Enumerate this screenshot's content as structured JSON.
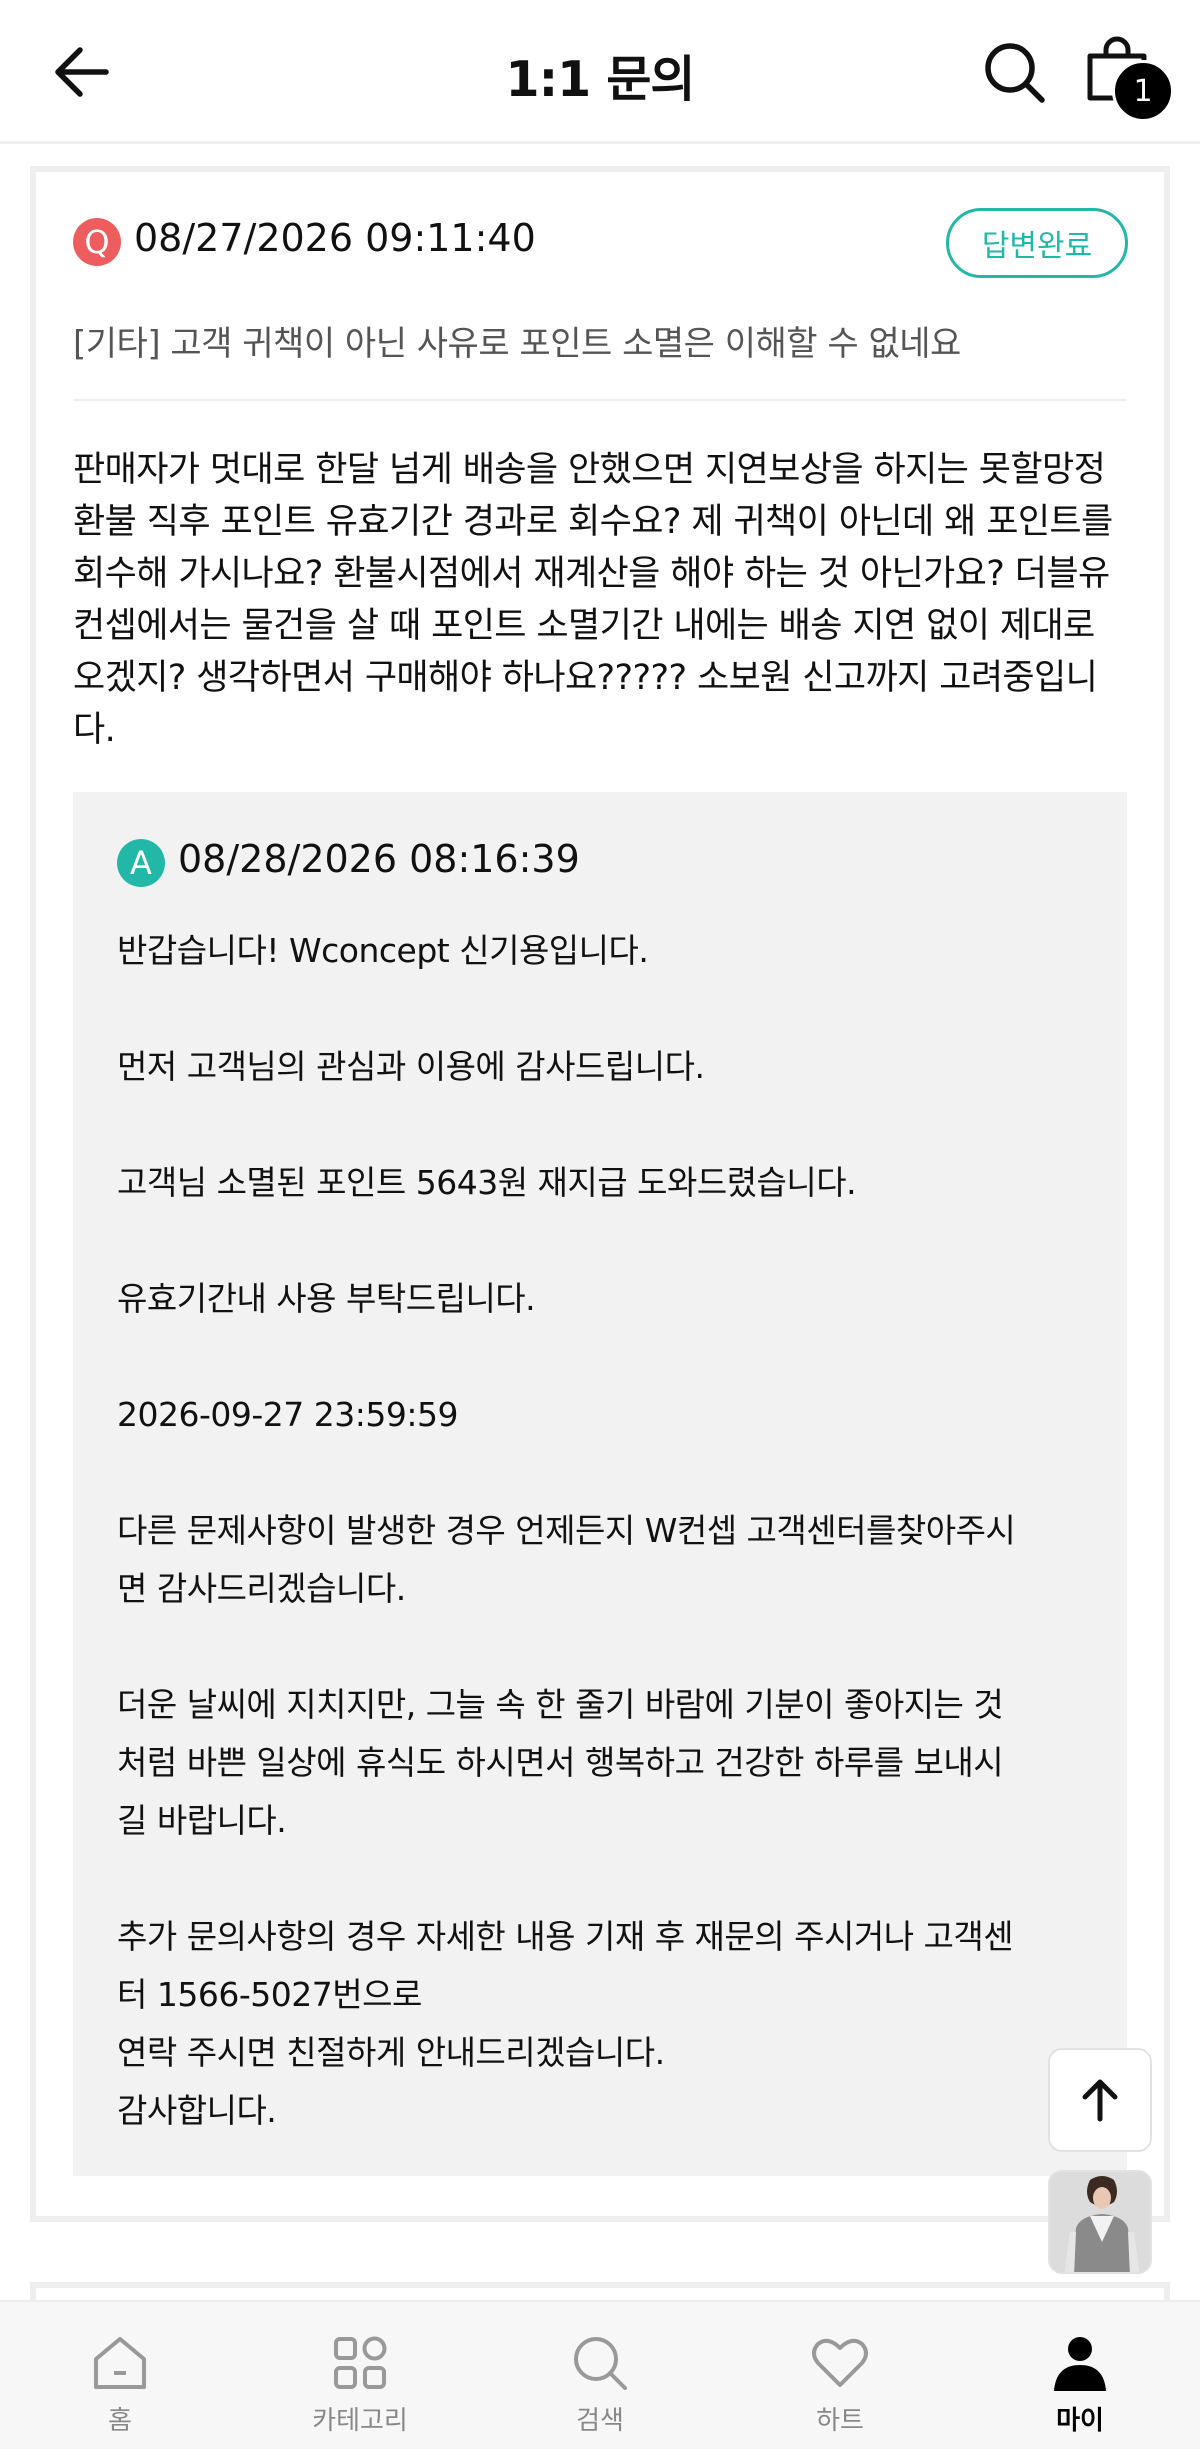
{
  "header": {
    "title": "1:1 문의",
    "cart_count": "1"
  },
  "question": {
    "icon_letter": "Q",
    "datetime": "08/27/2026 09:11:40",
    "status": "답변완료",
    "title": "[기타] 고객 귀책이 아닌 사유로 포인트 소멸은 이해할 수 없네요",
    "body_lines": [
      "판매자가 멋대로 한달 넘게 배송을 안했으면 지연보상을 하지는 못할망정",
      "환불 직후 포인트 유효기간 경과로 회수요? 제 귀책이 아닌데 왜 포인트를",
      "회수해 가시나요? 환불시점에서 재계산을 해야 하는 것 아닌가요? 더블유",
      "컨셉에서는 물건을 살 때 포인트 소멸기간 내에는 배송 지연 없이 제대로",
      "오겠지? 생각하면서 구매해야 하나요????? 소보원 신고까지 고려중입니",
      "다."
    ]
  },
  "answer": {
    "icon_letter": "A",
    "datetime": "08/28/2026 08:16:39",
    "p1": "반갑습니다! Wconcept 신기용입니다.",
    "p2": "먼저 고객님의 관심과 이용에 감사드립니다.",
    "p3": "고객님 소멸된 포인트 5643원 재지급 도와드렸습니다.",
    "p4": "유효기간내 사용 부탁드립니다.",
    "p5": "2026-09-27 23:59:59",
    "p6a": "다른 문제사항이 발생한 경우 언제든지 W컨셉 고객센터를찾아주시",
    "p6b": "면 감사드리겠습니다.",
    "p7a": "더운 날씨에 지치지만, 그늘 속 한 줄기 바람에 기분이 좋아지는 것",
    "p7b": "처럼 바쁜 일상에 휴식도 하시면서 행복하고 건강한 하루를 보내시",
    "p7c": "길 바랍니다.",
    "p8a": "추가 문의사항의 경우 자세한 내용 기재 후 재문의 주시거나 고객센",
    "p8b": "터 1566-5027번으로",
    "p8c": "연락 주시면 친절하게 안내드리겠습니다.",
    "p8d": "감사합니다."
  },
  "tabs": [
    {
      "label": "홈",
      "icon": "home-icon"
    },
    {
      "label": "카테고리",
      "icon": "category-icon"
    },
    {
      "label": "검색",
      "icon": "search-icon"
    },
    {
      "label": "하트",
      "icon": "heart-icon"
    },
    {
      "label": "마이",
      "icon": "person-icon"
    }
  ],
  "colors": {
    "accent": "#22b8a7",
    "question_icon": "#ee5d5d",
    "answer_bg": "#f2f2f2"
  }
}
